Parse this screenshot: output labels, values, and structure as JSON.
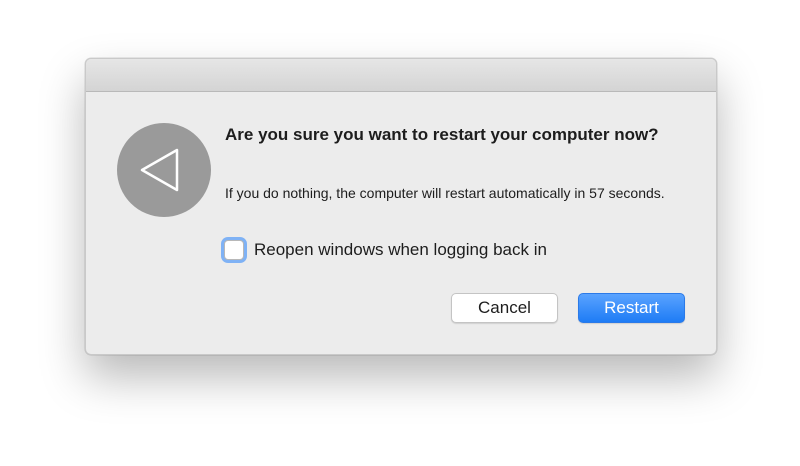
{
  "dialog": {
    "title": "Are you sure you want to restart your computer now?",
    "message": "If you do nothing, the computer will restart automatically in 57 seconds.",
    "icon": "restart-arrow-icon",
    "checkbox": {
      "label": "Reopen windows when logging back in",
      "checked": false
    },
    "buttons": {
      "cancel_label": "Cancel",
      "restart_label": "Restart"
    }
  },
  "colors": {
    "accent": "#1e7cf5",
    "focus_ring": "#7fb2f5",
    "icon_bg": "#9a9a9a",
    "dialog_bg": "#ececec"
  }
}
